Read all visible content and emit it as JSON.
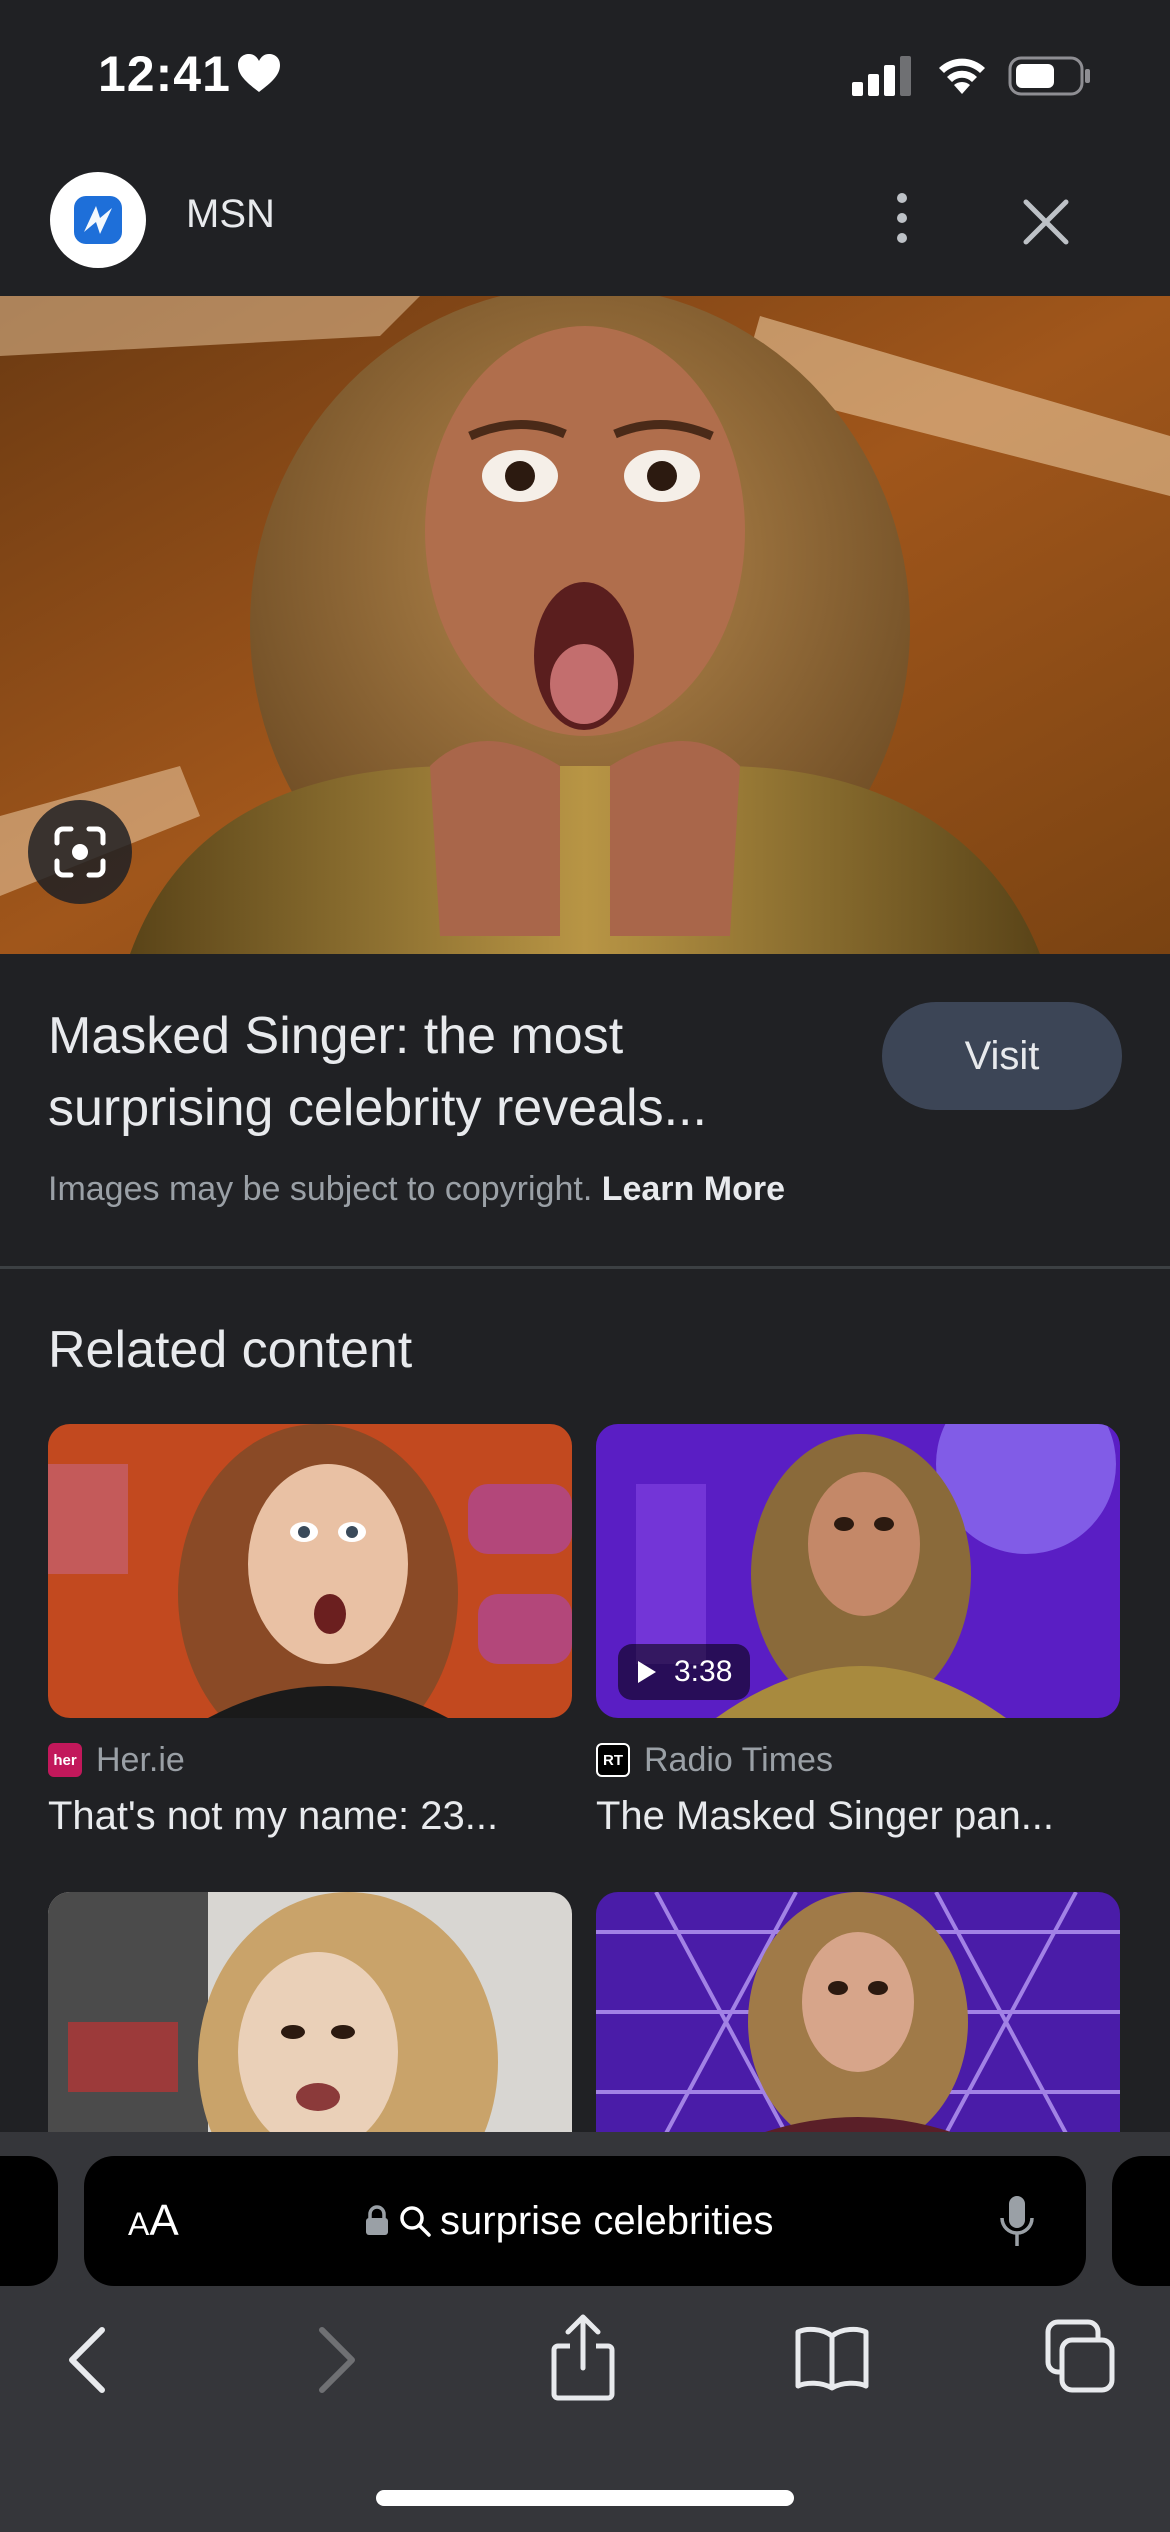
{
  "status_bar": {
    "time": "12:41"
  },
  "header": {
    "site_name": "MSN",
    "icons": [
      "msn-logo-icon",
      "more-vert-icon",
      "close-icon"
    ]
  },
  "hero": {
    "icons": [
      "google-lens-icon"
    ]
  },
  "result": {
    "title": "Masked Singer: the most surprising celebrity reveals...",
    "visit_label": "Visit",
    "copyright_text": "Images may be subject to copyright.",
    "learn_more_label": "Learn More"
  },
  "related": {
    "heading": "Related content",
    "cards": [
      {
        "source_logo_text": "her",
        "source": "Her.ie",
        "title": "That's not my name: 23...",
        "duration": ""
      },
      {
        "source_logo_text": "RT",
        "source": "Radio Times",
        "title": "The Masked Singer pan...",
        "duration": "3:38"
      }
    ]
  },
  "browser": {
    "text_size_label_small": "A",
    "text_size_label_large": "A",
    "url_text": "surprise celebrities",
    "icons": [
      "lock-icon",
      "search-icon",
      "mic-icon",
      "back-icon",
      "forward-icon",
      "share-icon",
      "bookmarks-icon",
      "tabs-icon"
    ]
  },
  "colors": {
    "background": "#202124",
    "visit_button": "#3c4556",
    "toolbar": "#35363a",
    "her_logo": "#c2185b",
    "rt_logo": "#000000"
  }
}
